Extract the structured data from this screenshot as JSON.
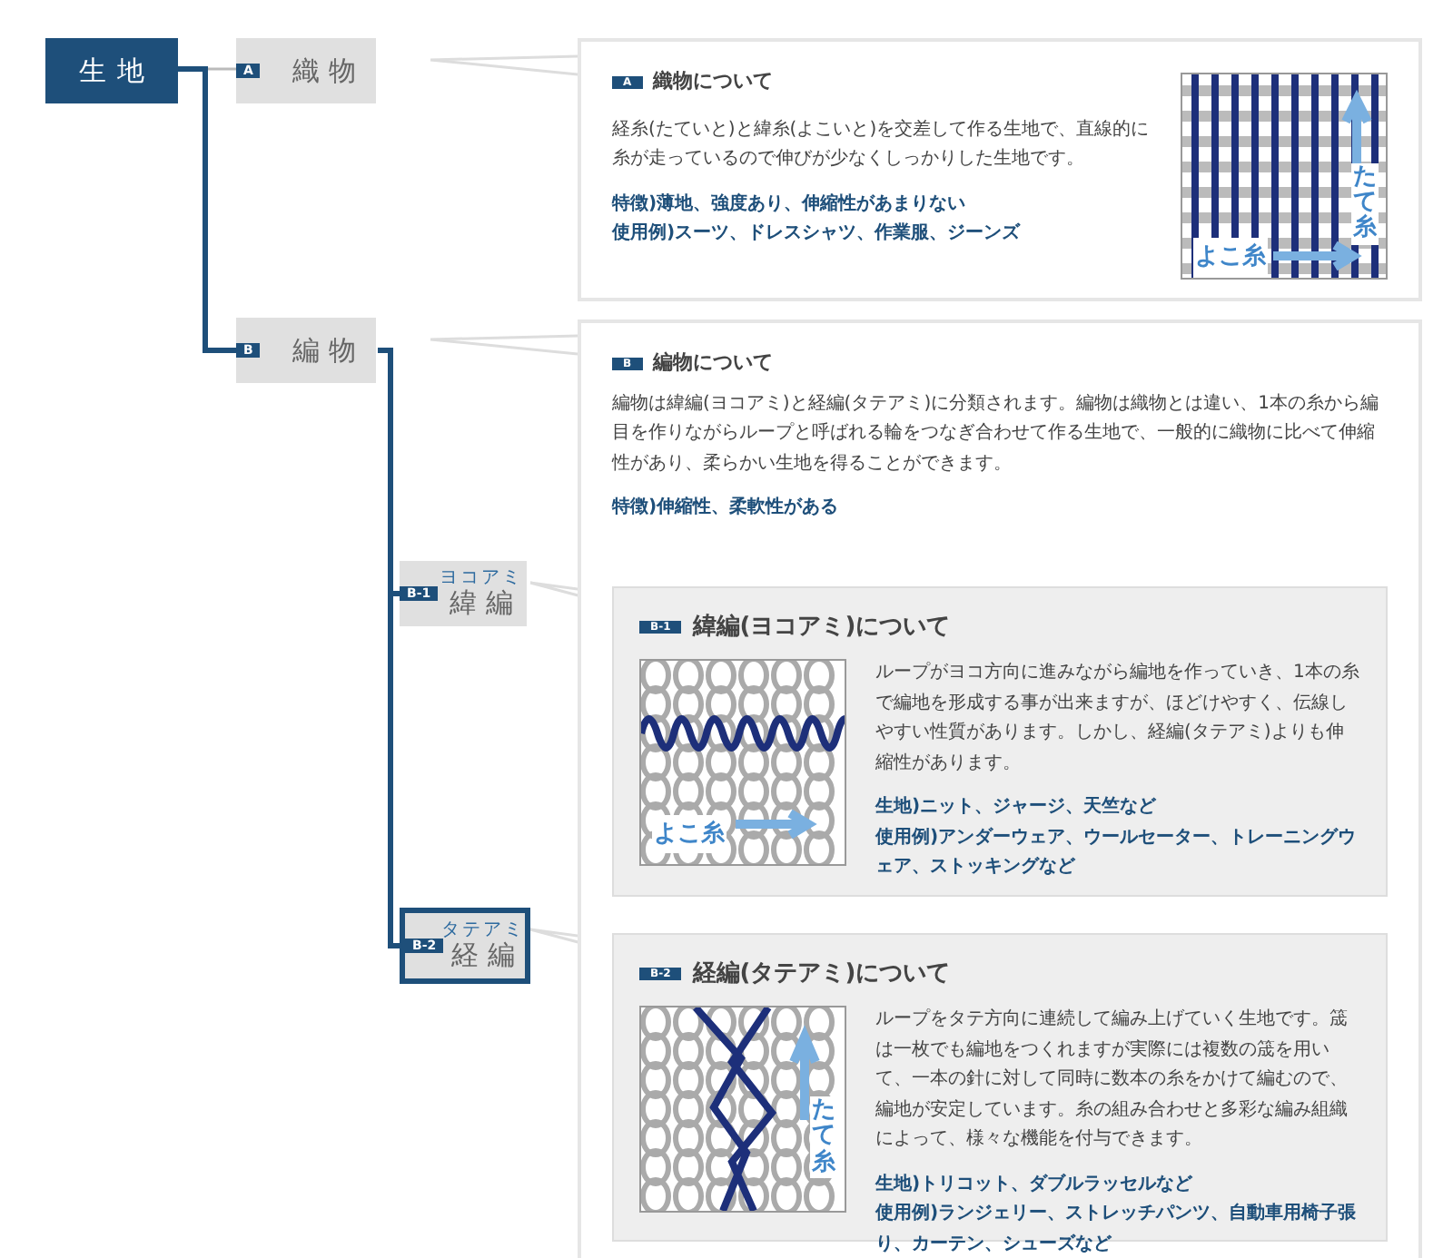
{
  "root": {
    "label": "生地"
  },
  "categories": [
    {
      "badge": "A",
      "label": "織物",
      "card": {
        "badge": "A",
        "title": "織物について",
        "description": "経糸(たていと)と緯糸(よこいと)を交差して作る生地で、直線的に糸が走っているので伸びが少なくしっかりした生地です。",
        "notes": [
          "特徴)薄地、強度あり、伸縮性があまりない",
          "使用例)スーツ、ドレスシャツ、作業服、ジーンズ"
        ],
        "diagram": {
          "kind": "weave",
          "labels": [
            {
              "text": "たて糸",
              "kind": "vertical"
            },
            {
              "text": "よこ糸",
              "kind": "horizontal"
            }
          ]
        }
      }
    },
    {
      "badge": "B",
      "label": "編物",
      "card": {
        "badge": "B",
        "title": "編物について",
        "description": "編物は緯編(ヨコアミ)と経編(タテアミ)に分類されます。編物は織物とは違い、1本の糸から編目を作りながらループと呼ばれる輪をつなぎ合わせて作る生地で、一般的に織物に比べて伸縮性があり、柔らかい生地を得ることができます。",
        "notes": [
          "特徴)伸縮性、柔軟性がある"
        ]
      },
      "subtypes": [
        {
          "badge": "B-1",
          "reading": "ヨコアミ",
          "label": "緯編",
          "selected": false,
          "card": {
            "badge": "B-1",
            "title": "緯編(ヨコアミ)について",
            "description": "ループがヨコ方向に進みながら編地を作っていき、1本の糸で編地を形成する事が出来ますが、ほどけやすく、伝線しやすい性質があります。しかし、経編(タテアミ)よりも伸縮性があります。",
            "notes": [
              "生地)ニット、ジャージ、天竺など",
              "使用例)アンダーウェア、ウールセーター、トレーニングウェア、ストッキングなど"
            ],
            "diagram": {
              "kind": "weft_knit",
              "labels": [
                {
                  "text": "よこ糸",
                  "kind": "horizontal"
                }
              ]
            }
          }
        },
        {
          "badge": "B-2",
          "reading": "タテアミ",
          "label": "経編",
          "selected": true,
          "card": {
            "badge": "B-2",
            "title": "経編(タテアミ)について",
            "description": "ループをタテ方向に連続して編み上げていく生地です。筬は一枚でも編地をつくれますが実際には複数の筬を用いて、一本の針に対して同時に数本の糸をかけて編むので、編地が安定しています。糸の組み合わせと多彩な編み組織によって、様々な機能を付与できます。",
            "notes": [
              "生地)トリコット、ダブルラッセルなど",
              "使用例)ランジェリー、ストレッチパンツ、自動車用椅子張り、カーテン、シューズなど"
            ],
            "diagram": {
              "kind": "warp_knit",
              "labels": [
                {
                  "text": "たて糸",
                  "kind": "vertical"
                }
              ]
            }
          }
        }
      ]
    }
  ]
}
